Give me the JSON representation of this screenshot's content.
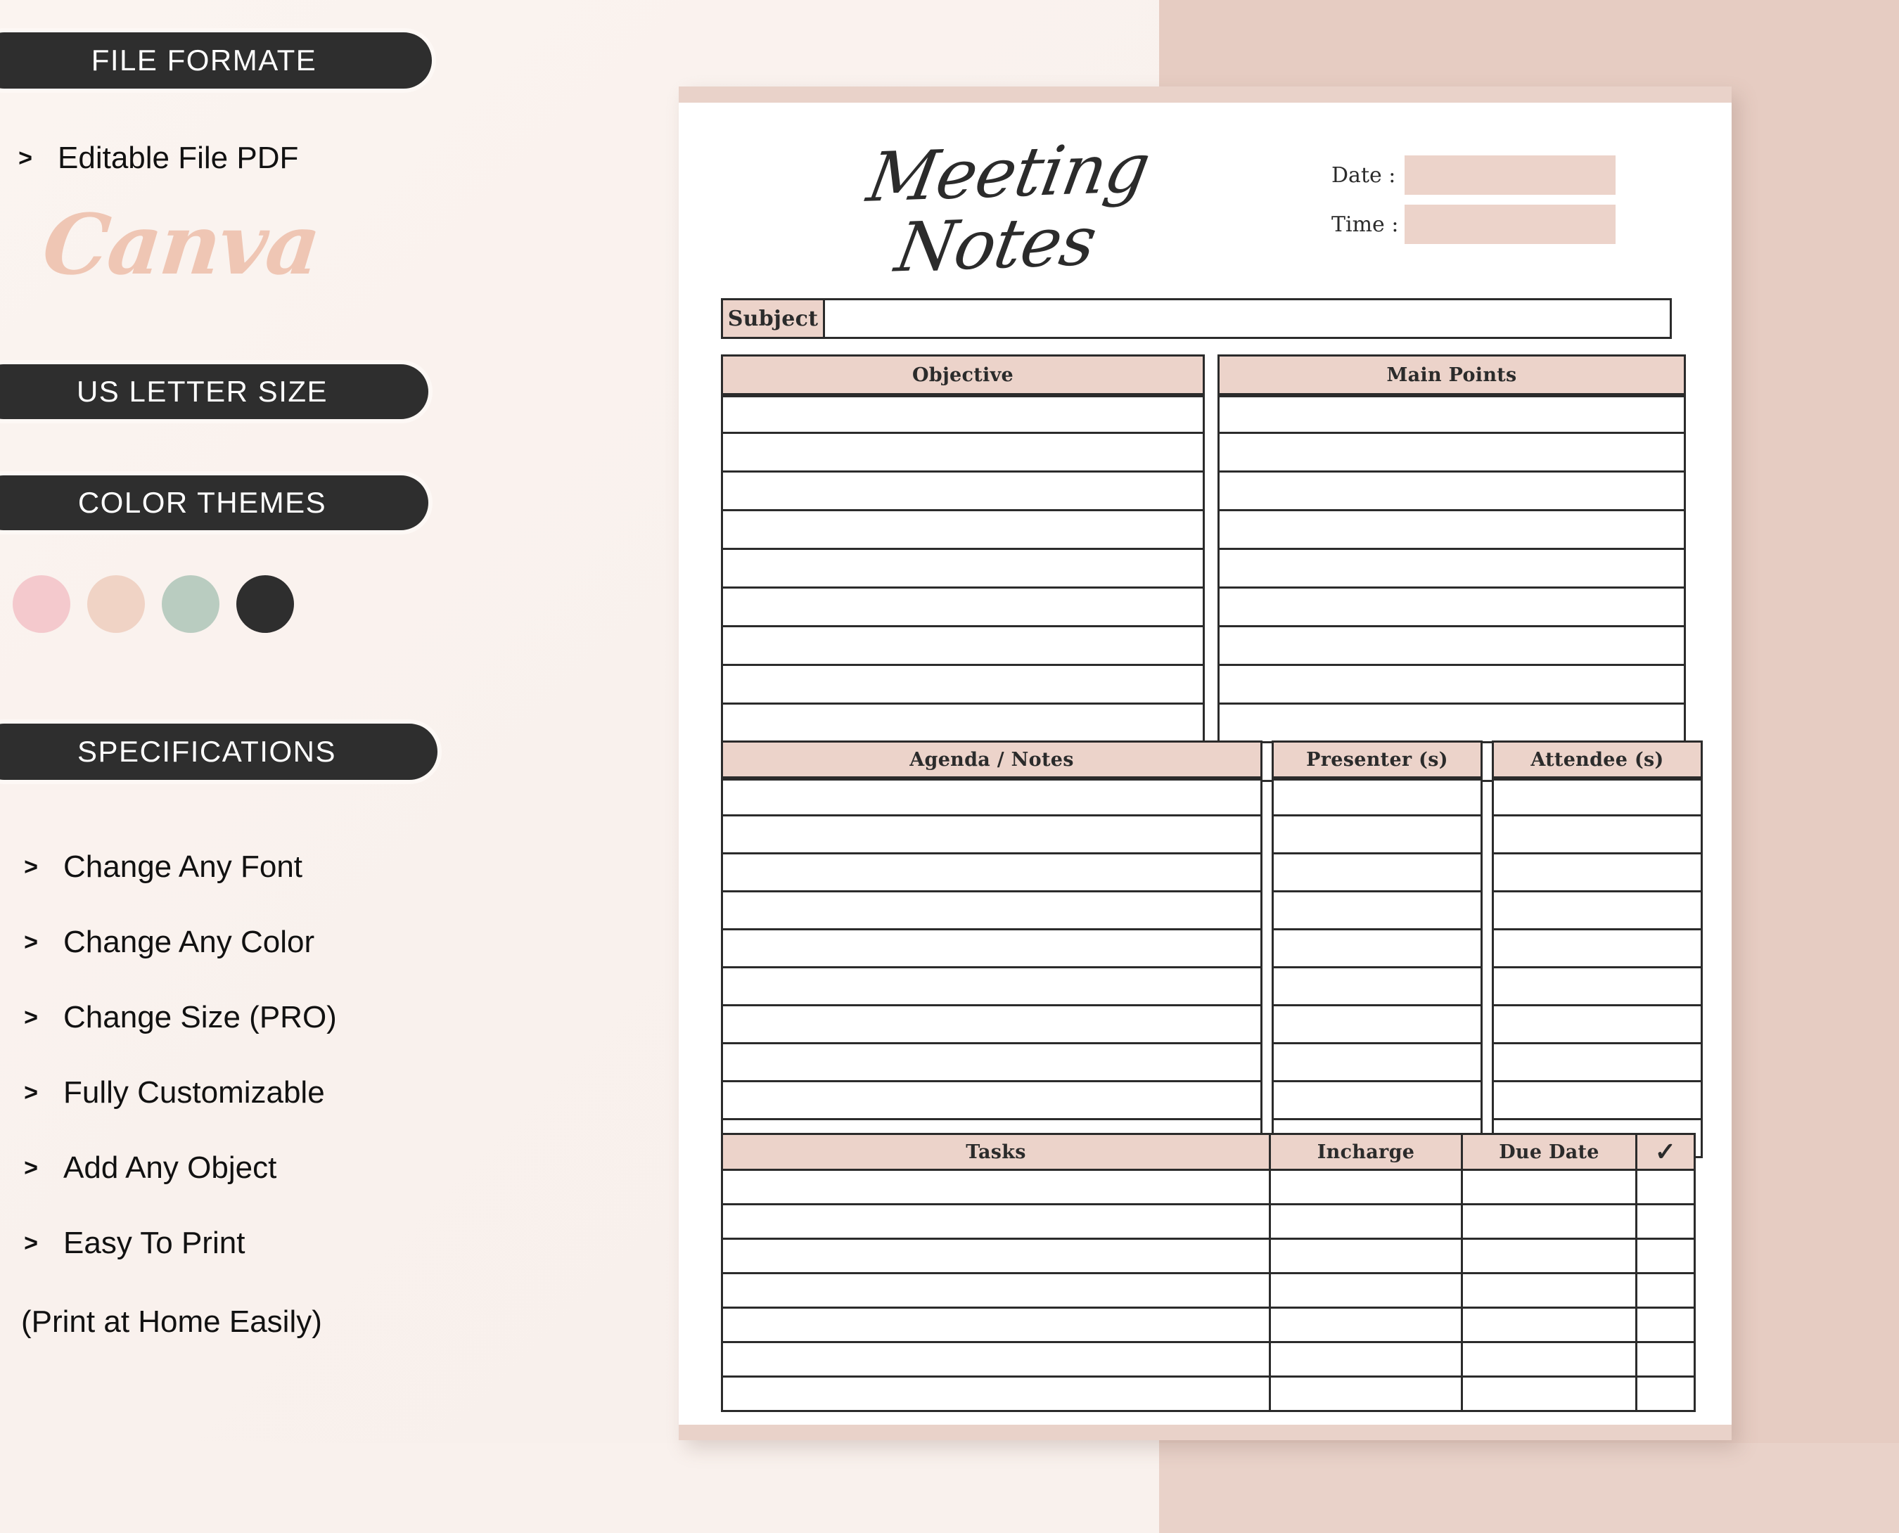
{
  "theme": {
    "dark": "#2e2e2e",
    "blush": "#ecd3ca",
    "blush_block": "#e6ccc2",
    "cream": "#f9f1ed",
    "canva_pink": "#efc6b4",
    "ink": "#2b2b2b"
  },
  "sidebar": {
    "badges": [
      {
        "label": "FILE FORMATE"
      },
      {
        "label": "US LETTER SIZE"
      },
      {
        "label": "COLOR THEMES"
      },
      {
        "label": "SPECIFICATIONS"
      }
    ],
    "file_format_item": "Editable File PDF",
    "canva_logo": "Canva",
    "bullet_glyph": ">",
    "swatches": [
      {
        "name": "pink",
        "hex": "#f4c9cd"
      },
      {
        "name": "peach",
        "hex": "#f0d3c5"
      },
      {
        "name": "sage",
        "hex": "#b9ccc0"
      },
      {
        "name": "charcoal",
        "hex": "#2e2e2e"
      }
    ],
    "specifications": [
      "Change Any Font",
      "Change Any Color",
      "Change Size (PRO)",
      "Fully Customizable",
      "Add Any Object",
      "Easy To Print"
    ],
    "print_note": "(Print at Home Easily)"
  },
  "page": {
    "title": "Meeting Notes",
    "date_label": "Date :",
    "time_label": "Time :",
    "date_value": "",
    "time_value": "",
    "subject_label": "Subject",
    "subject_value": "",
    "objective_header": "Objective",
    "main_points_header": "Main Points",
    "objective_rows": 10,
    "main_points_rows": 10,
    "agenda_header": "Agenda / Notes",
    "presenter_header": "Presenter (s)",
    "attendee_header": "Attendee (s)",
    "agenda_rows": 10,
    "tasks_headers": [
      "Tasks",
      "Incharge",
      "Due Date"
    ],
    "tasks_check_glyph": "✓",
    "tasks_rows": 7
  }
}
